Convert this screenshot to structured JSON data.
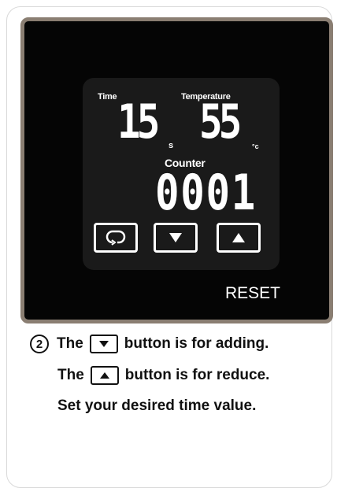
{
  "display": {
    "time_label": "Time",
    "temperature_label": "Temperature",
    "time_value": "15",
    "time_unit": "s",
    "temperature_value": "55",
    "temperature_unit": "°c",
    "counter_label": "Counter",
    "counter_value": "0001"
  },
  "buttons": {
    "cycle_icon": "cycle-icon",
    "down_icon": "down-triangle-icon",
    "up_icon": "up-triangle-icon"
  },
  "reset_label": "RESET",
  "instructions": {
    "step_number": "2",
    "line1_prefix": "The",
    "line1_suffix": "button is for adding.",
    "line2_prefix": "The",
    "line2_suffix": "button is for reduce.",
    "line3": "Set your desired time value."
  },
  "colors": {
    "device_bg": "#050505",
    "device_border": "#8a7e72",
    "screen_bg": "#1a1a1a",
    "text": "#111111"
  }
}
